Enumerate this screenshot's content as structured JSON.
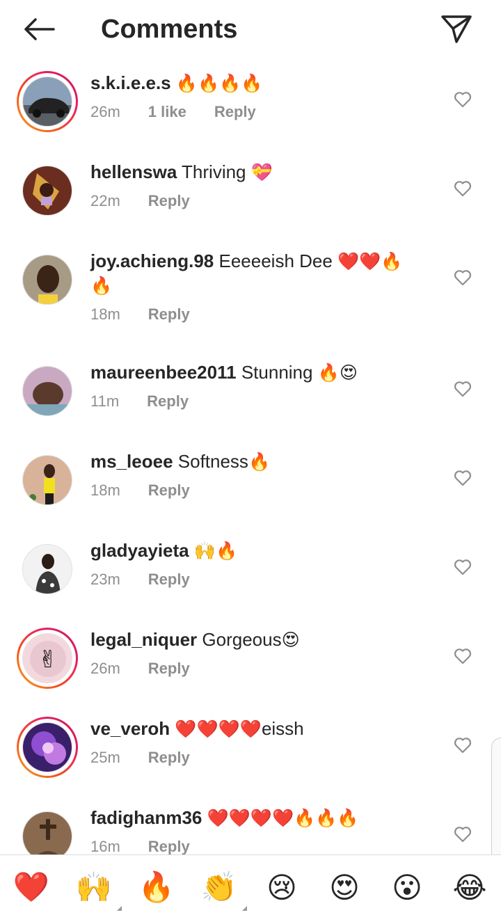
{
  "header": {
    "title": "Comments",
    "back_icon": "arrow-left-icon",
    "send_icon": "paper-plane-icon"
  },
  "comments": [
    {
      "username": "s.k.i.e.e.s",
      "text": "",
      "emoji": "🔥🔥🔥🔥",
      "time": "26m",
      "likes": "1 like",
      "reply": "Reply"
    },
    {
      "username": "hellenswa",
      "text": "Thriving",
      "emoji": "💝",
      "time": "22m",
      "likes": "",
      "reply": "Reply"
    },
    {
      "username": "joy.achieng.98",
      "text": "Eeeeeish Dee",
      "emoji": "❤️❤️🔥",
      "emoji_line2": "🔥",
      "time": "18m",
      "likes": "",
      "reply": "Reply"
    },
    {
      "username": "maureenbee2011",
      "text": "Stunning",
      "emoji": "🔥😍",
      "time": "11m",
      "likes": "",
      "reply": "Reply"
    },
    {
      "username": "ms_leoee",
      "text": "Softness",
      "emoji": "🔥",
      "time": "18m",
      "likes": "",
      "reply": "Reply"
    },
    {
      "username": "gladyayieta",
      "text": "",
      "emoji": "🙌🔥",
      "time": "23m",
      "likes": "",
      "reply": "Reply"
    },
    {
      "username": "legal_niquer",
      "text": "Gorgeous",
      "emoji": "😍",
      "time": "26m",
      "likes": "",
      "reply": "Reply"
    },
    {
      "username": "ve_veroh",
      "text": "eissh",
      "emoji": "❤️❤️❤️❤️",
      "time": "25m",
      "likes": "",
      "reply": "Reply"
    },
    {
      "username": "fadighanm36",
      "text": "",
      "emoji": "❤️❤️❤️❤️🔥🔥🔥",
      "time": "16m",
      "likes": "",
      "reply": "Reply"
    }
  ],
  "reactions": [
    "❤️",
    "🙌",
    "🔥",
    "👏",
    "😢",
    "😍",
    "😮",
    "😂"
  ],
  "colors": {
    "text": "#262626",
    "meta": "#8e8e8e",
    "divider": "#dbdbdb",
    "ring_start": "#f9a825",
    "ring_end": "#c2185b"
  }
}
